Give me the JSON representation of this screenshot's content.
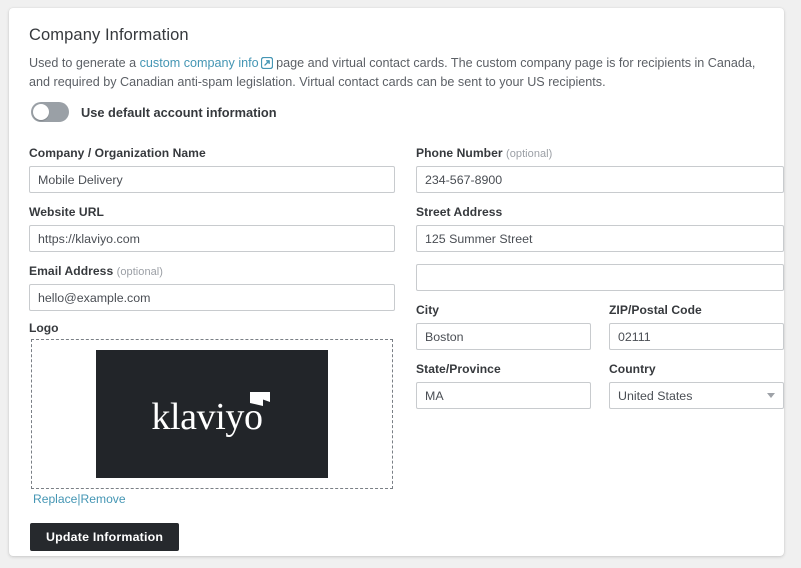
{
  "section": {
    "title": "Company Information",
    "description_part1": "Used to generate a ",
    "description_link": "custom company info",
    "description_link_icon": "external-link-icon",
    "description_part2": " page and virtual contact cards. The custom company page is for recipients in Canada, and required by Canadian anti-spam legislation. Virtual contact cards can be sent to your US recipients."
  },
  "toggle": {
    "label": "Use default account information",
    "state": "off"
  },
  "left_column": {
    "company_name": {
      "label": "Company / Organization Name",
      "value": "Mobile Delivery",
      "placeholder": ""
    },
    "website_url": {
      "label": "Website URL",
      "value": "https://klaviyo.com",
      "placeholder": ""
    },
    "email_address": {
      "label": "Email Address",
      "optional": "(optional)",
      "value": "hello@example.com",
      "placeholder": ""
    }
  },
  "right_column": {
    "phone_number": {
      "label": "Phone Number",
      "optional": "(optional)",
      "value": "234-567-8900",
      "placeholder": ""
    },
    "street_address": {
      "label": "Street Address",
      "value": "125 Summer Street",
      "placeholder": ""
    },
    "street_address_2": {
      "label": "",
      "value": "",
      "placeholder": ""
    },
    "city": {
      "label": "City",
      "value": "Boston",
      "placeholder": ""
    },
    "zip": {
      "label": "ZIP/Postal Code",
      "value": "02111",
      "placeholder": ""
    },
    "state": {
      "label": "State/Province",
      "value": "MA",
      "placeholder": ""
    },
    "country": {
      "label": "Country",
      "value": "United States",
      "options": [
        "United States"
      ]
    }
  },
  "logo": {
    "label": "Logo",
    "wordmark": "klaviyo",
    "replace_label": "Replace",
    "separator": "|",
    "remove_label": "Remove"
  },
  "actions": {
    "update_label": "Update Information"
  },
  "colors": {
    "link": "#4596b4",
    "button_bg": "#26292d",
    "logo_bg": "#222529",
    "text": "#36393d",
    "muted": "#9b9fa5",
    "border": "#c8cbce"
  }
}
